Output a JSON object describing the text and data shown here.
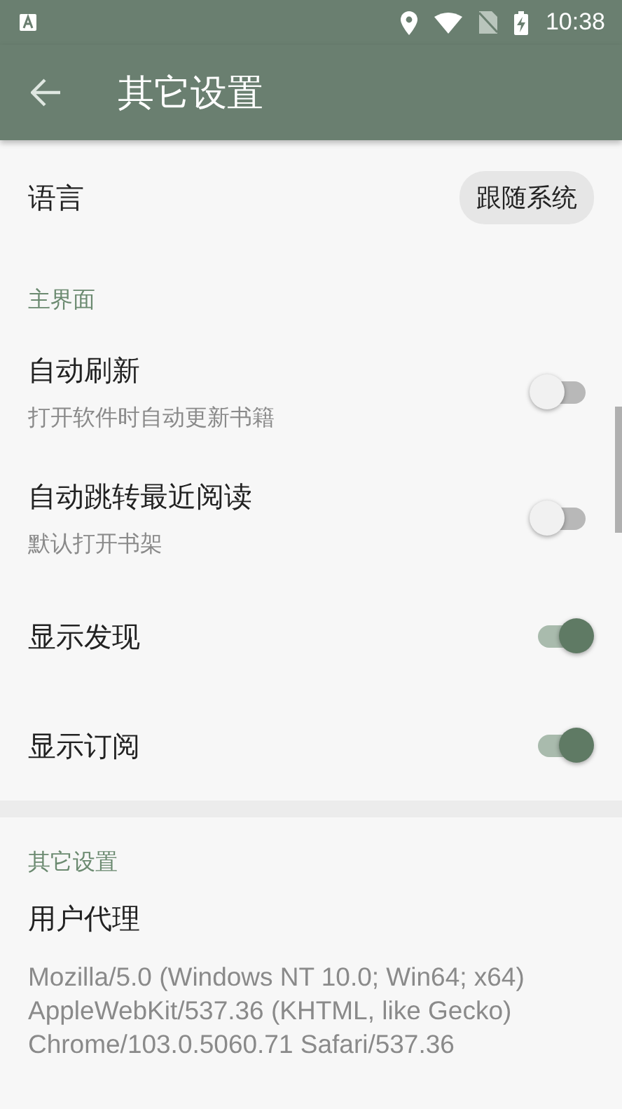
{
  "status_bar": {
    "time": "10:38"
  },
  "app_bar": {
    "title": "其它设置"
  },
  "sections": [
    {
      "items": [
        {
          "kind": "choice",
          "title": "语言",
          "value": "跟随系统"
        }
      ]
    },
    {
      "header": "主界面",
      "items": [
        {
          "kind": "switch",
          "title": "自动刷新",
          "summary": "打开软件时自动更新书籍",
          "on": false
        },
        {
          "kind": "switch",
          "title": "自动跳转最近阅读",
          "summary": "默认打开书架",
          "on": false
        },
        {
          "kind": "switch",
          "title": "显示发现",
          "on": true
        },
        {
          "kind": "switch",
          "title": "显示订阅",
          "on": true
        }
      ]
    },
    {
      "header": "其它设置",
      "items": [
        {
          "kind": "text",
          "title": "用户代理",
          "summary": "Mozilla/5.0 (Windows NT 10.0; Win64; x64) AppleWebKit/537.36 (KHTML, like Gecko) Chrome/103.0.5060.71 Safari/537.36"
        }
      ]
    }
  ]
}
